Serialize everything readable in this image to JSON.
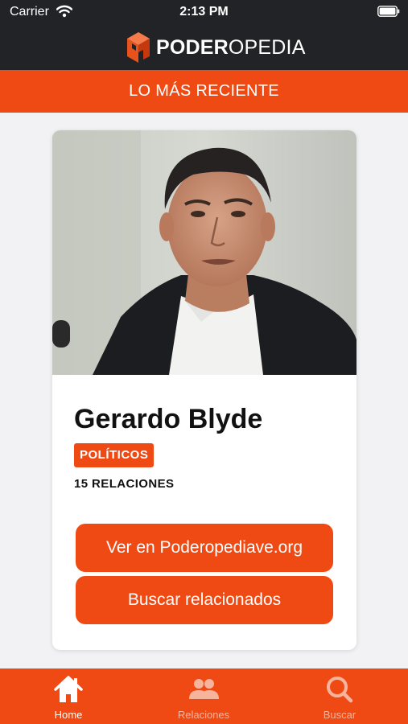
{
  "status_bar": {
    "carrier": "Carrier",
    "time": "2:13 PM"
  },
  "header": {
    "logo_bold": "PODER",
    "logo_light": "OPEDIA"
  },
  "section": {
    "title": "LO MÁS RECIENTE"
  },
  "card": {
    "photo_icon": "portrait-photo",
    "name": "Gerardo Blyde",
    "tag": "POLÍTICOS",
    "relations": "15 RELACIONES",
    "buttons": {
      "web": "Ver en Poderopediave.org",
      "related": "Buscar relacionados"
    }
  },
  "tab_bar": {
    "items": [
      {
        "label": "Home",
        "icon": "home-icon",
        "active": true
      },
      {
        "label": "Relaciones",
        "icon": "people-icon",
        "active": false
      },
      {
        "label": "Buscar",
        "icon": "search-icon",
        "active": false
      }
    ]
  },
  "colors": {
    "accent": "#f04a14",
    "header_bg": "#222326",
    "background": "#f2f2f4",
    "inactive_tab": "#f7b49c"
  }
}
